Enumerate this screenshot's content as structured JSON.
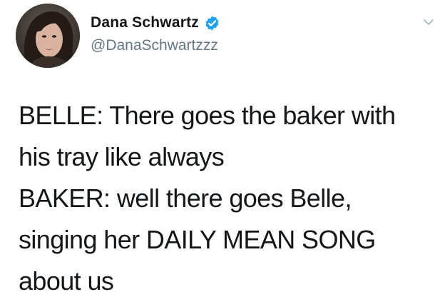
{
  "author": {
    "display_name": "Dana Schwartz",
    "handle": "@DanaSchwartzzz",
    "verified": true,
    "avatar_icon": "profile-photo"
  },
  "menu": {
    "icon": "chevron-down-icon"
  },
  "tweet": {
    "lines": [
      "BELLE: There goes the baker with",
      "his tray like always",
      "BAKER: well there goes Belle,",
      "singing her DAILY MEAN SONG",
      "about us"
    ]
  },
  "colors": {
    "text": "#14171a",
    "handle": "#657786",
    "verified_badge": "#1da1f2",
    "background": "#ffffff"
  }
}
